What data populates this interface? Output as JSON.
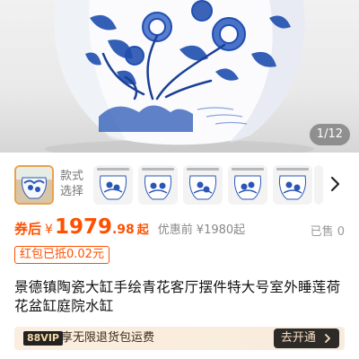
{
  "hero": {
    "image_description": "Blue and white porcelain vat with peony flowers",
    "counter": "1/12"
  },
  "variants": {
    "label": "款式选择",
    "thumbnail_count": 5,
    "thumbnail_caption": "景德镇陶瓷大缸"
  },
  "price": {
    "coupon_label": "券后",
    "currency": "¥",
    "integer": "1979",
    "decimal": ".98",
    "suffix": "起",
    "original_label": "优惠前",
    "original_price": "¥1980起",
    "sold": "已售 0"
  },
  "tag": {
    "text": "红包已抵0.02元"
  },
  "product": {
    "title": "景德镇陶瓷大缸手绘青花客厅摆件特大号室外睡莲荷花盆缸庭院水缸"
  },
  "vip": {
    "badge": "88VIP",
    "text": "享无限退货包运费",
    "button": "去开通"
  },
  "colors": {
    "accent": "#ff5000",
    "porcelain_blue": "#1f4fb0",
    "vip_bg": "#fbeede",
    "vip_button": "#2d2a28"
  },
  "icons": {
    "chevron": "chevron-right-icon",
    "vip_arrow": "chevron-right-icon"
  }
}
